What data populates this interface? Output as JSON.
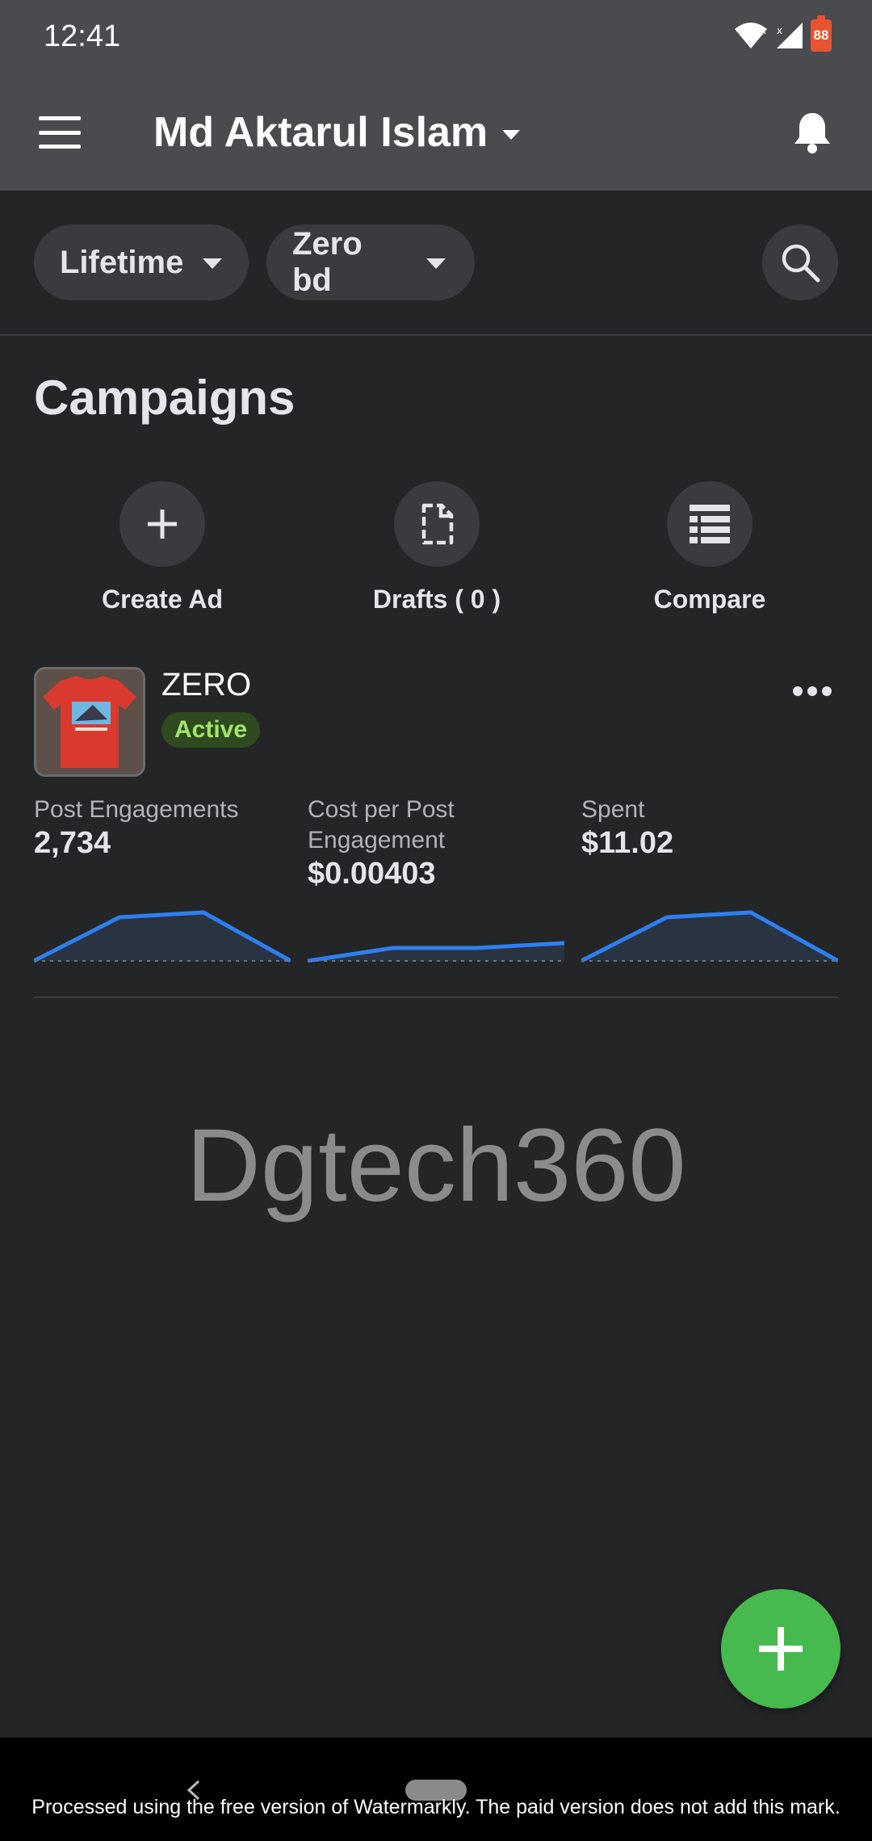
{
  "status_bar": {
    "time": "12:41",
    "battery": "88"
  },
  "header": {
    "account_name": "Md Aktarul Islam"
  },
  "filters": {
    "date_range": "Lifetime",
    "ad_account": "Zero bd"
  },
  "section": {
    "title": "Campaigns"
  },
  "actions": [
    {
      "label": "Create Ad",
      "icon": "plus-icon"
    },
    {
      "label": "Drafts ( 0 )",
      "icon": "document-icon"
    },
    {
      "label": "Compare",
      "icon": "list-icon"
    }
  ],
  "campaign": {
    "name": "ZERO",
    "status": "Active",
    "status_color": "#a4e36a",
    "metrics": [
      {
        "label": "Post Engagements",
        "value": "2,734"
      },
      {
        "label": "Cost per Post Engagement",
        "value": "$0.00403"
      },
      {
        "label": "Spent",
        "value": "$11.02"
      }
    ]
  },
  "watermark": "Dgtech360",
  "footer_note": "Processed using the free version of Watermarkly. The paid version does not add this mark.",
  "colors": {
    "accent_blue": "#2d7ff0",
    "fab_green": "#46b94f",
    "header_bg": "#4a4b4f",
    "page_bg": "#242527"
  }
}
